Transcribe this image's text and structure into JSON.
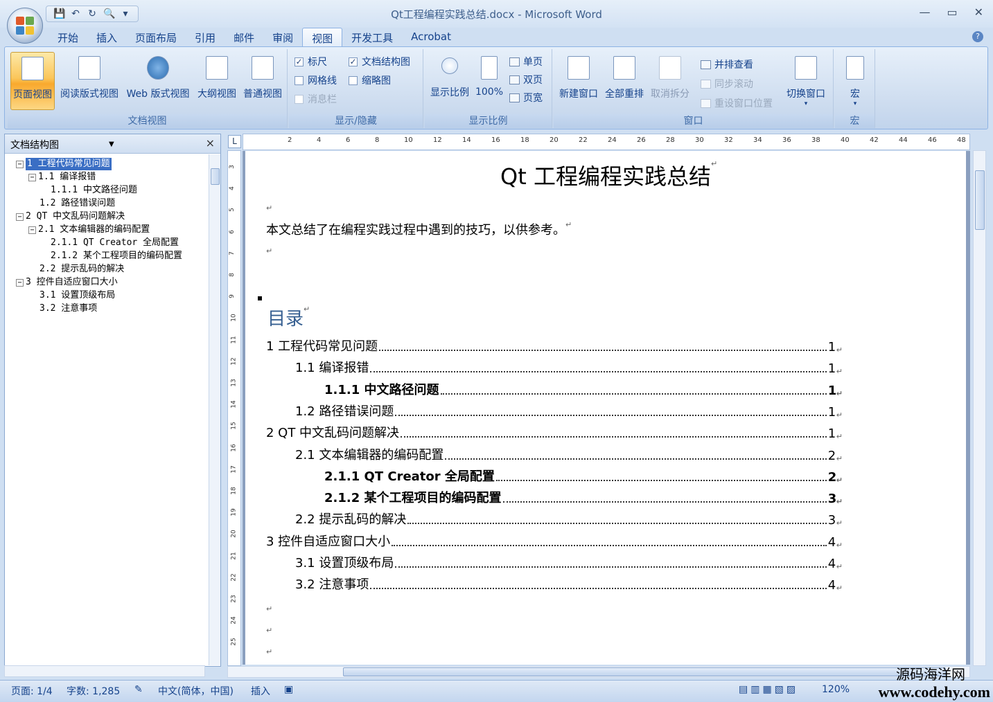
{
  "window": {
    "title": "Qt工程编程实践总结.docx - Microsoft Word",
    "min": "—",
    "max": "▭",
    "close": "✕"
  },
  "qat": {
    "save": "💾",
    "undo": "↶",
    "redo": "↻",
    "print_preview": "🔍",
    "customize": "▾"
  },
  "tabs": [
    "开始",
    "插入",
    "页面布局",
    "引用",
    "邮件",
    "审阅",
    "视图",
    "开发工具",
    "Acrobat"
  ],
  "active_tab": "视图",
  "ribbon": {
    "doc_views": {
      "label": "文档视图",
      "buttons": [
        "页面视图",
        "阅读版式视图",
        "Web 版式视图",
        "大纲视图",
        "普通视图"
      ]
    },
    "show_hide": {
      "label": "显示/隐藏",
      "ruler": "标尺",
      "gridlines": "网格线",
      "message_bar": "消息栏",
      "doc_map": "文档结构图",
      "thumbnails": "缩略图"
    },
    "zoom": {
      "label": "显示比例",
      "zoom": "显示比例",
      "hundred": "100%",
      "one_page": "单页",
      "two_pages": "双页",
      "page_width": "页宽"
    },
    "window": {
      "label": "窗口",
      "new_window": "新建窗口",
      "arrange_all": "全部重排",
      "split": "取消拆分",
      "side_by_side": "并排查看",
      "sync_scroll": "同步滚动",
      "reset_pos": "重设窗口位置",
      "switch": "切换窗口"
    },
    "macros": {
      "label": "宏",
      "macros": "宏"
    }
  },
  "doc_map": {
    "title": "文档结构图",
    "nodes": [
      {
        "toggle": "−",
        "label": "1  工程代码常见问题",
        "selected": true
      },
      {
        "toggle": "−",
        "label": "1.1 编译报错"
      },
      {
        "toggle": "",
        "label": "1.1.1  中文路径问题"
      },
      {
        "toggle": "",
        "label": "1.2 路径错误问题"
      },
      {
        "toggle": "−",
        "label": "2 QT 中文乱码问题解决"
      },
      {
        "toggle": "−",
        "label": "2.1 文本编辑器的编码配置"
      },
      {
        "toggle": "",
        "label": "2.1.1  QT Creator 全局配置"
      },
      {
        "toggle": "",
        "label": "2.1.2  某个工程项目的编码配置"
      },
      {
        "toggle": "",
        "label": "2.2 提示乱码的解决"
      },
      {
        "toggle": "−",
        "label": "3  控件自适应窗口大小"
      },
      {
        "toggle": "",
        "label": "3.1 设置顶级布局"
      },
      {
        "toggle": "",
        "label": "3.2 注意事项"
      }
    ]
  },
  "ruler": {
    "h_ticks": [
      "2",
      "4",
      "6",
      "8",
      "10",
      "12",
      "14",
      "16",
      "18",
      "20",
      "22",
      "24",
      "26",
      "28",
      "30",
      "32",
      "34",
      "36",
      "38",
      "40",
      "42",
      "44",
      "46",
      "48"
    ],
    "v_ticks": [
      "3",
      "4",
      "5",
      "6",
      "7",
      "8",
      "9",
      "10",
      "11",
      "12",
      "13",
      "14",
      "15",
      "16",
      "17",
      "18",
      "19",
      "20",
      "21",
      "22",
      "23",
      "24",
      "25"
    ]
  },
  "document": {
    "title": "Qt 工程编程实践总结",
    "paragraph_mark": "↵",
    "intro": "本文总结了在编程实践过程中遇到的技巧，以供参考。",
    "toc_heading": "目录",
    "toc": [
      {
        "text": "1  工程代码常见问题",
        "page": "1",
        "level": 1,
        "bold": false
      },
      {
        "text": "1.1 编译报错",
        "page": "1",
        "level": 2,
        "bold": false
      },
      {
        "text": "1.1.1    中文路径问题",
        "page": "1",
        "level": 3,
        "bold": true
      },
      {
        "text": "1.2 路径错误问题",
        "page": "1",
        "level": 2,
        "bold": false
      },
      {
        "text": "2 QT 中文乱码问题解决",
        "page": "1",
        "level": 1,
        "bold": false
      },
      {
        "text": "2.1 文本编辑器的编码配置",
        "page": "2",
        "level": 2,
        "bold": false
      },
      {
        "text": "2.1.1    QT Creator 全局配置",
        "page": "2",
        "level": 3,
        "bold": true
      },
      {
        "text": "2.1.2    某个工程项目的编码配置",
        "page": "3",
        "level": 3,
        "bold": true
      },
      {
        "text": "2.2  提示乱码的解决",
        "page": "3",
        "level": 2,
        "bold": false
      },
      {
        "text": "3    控件自适应窗口大小",
        "page": "4",
        "level": 1,
        "bold": false
      },
      {
        "text": "3.1 设置顶级布局",
        "page": "4",
        "level": 2,
        "bold": false
      },
      {
        "text": "3.2  注意事项",
        "page": "4",
        "level": 2,
        "bold": false
      }
    ]
  },
  "status": {
    "page": "页面: 1/4",
    "words": "字数: 1,285",
    "language": "中文(简体，中国)",
    "mode": "插入",
    "zoom": "120%"
  },
  "watermark": {
    "line1": "源码海洋网",
    "line2": "www.codehy.com"
  },
  "colors": {
    "accent": "#15428b",
    "toc_heading": "#365f91",
    "selection": "#3a6ec4"
  }
}
